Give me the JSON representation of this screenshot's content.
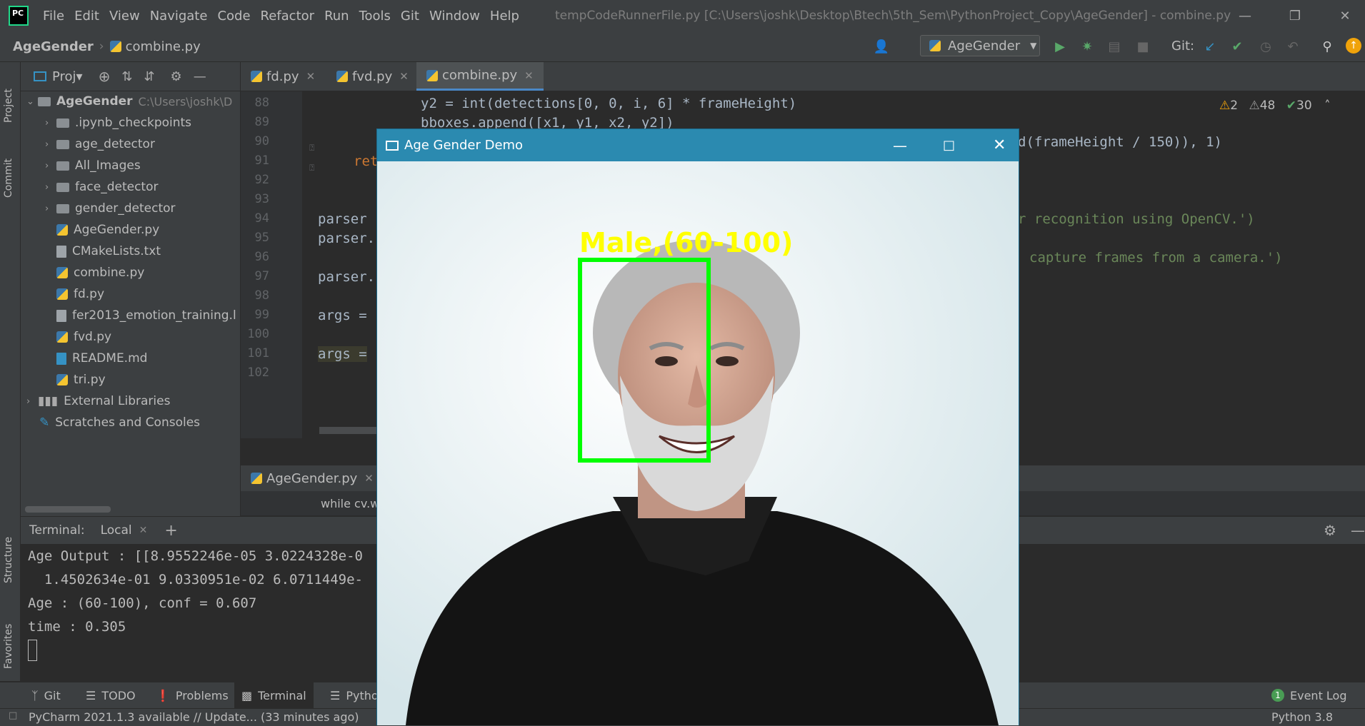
{
  "menubar": {
    "logo": "PC",
    "items": [
      "File",
      "Edit",
      "View",
      "Navigate",
      "Code",
      "Refactor",
      "Run",
      "Tools",
      "Git",
      "Window",
      "Help"
    ],
    "title": "tempCodeRunnerFile.py [C:\\Users\\joshk\\Desktop\\Btech\\5th_Sem\\PythonProject_Copy\\AgeGender] - combine.py"
  },
  "navbar": {
    "project": "AgeGender",
    "file": "combine.py",
    "run_config": "AgeGender",
    "git_label": "Git:"
  },
  "project_panel": {
    "title": "Proj▾",
    "root": "AgeGender",
    "root_path": "C:\\Users\\joshk\\D",
    "items": [
      {
        "label": ".ipynb_checkpoints",
        "type": "folder"
      },
      {
        "label": "age_detector",
        "type": "folder"
      },
      {
        "label": "All_Images",
        "type": "folder"
      },
      {
        "label": "face_detector",
        "type": "folder"
      },
      {
        "label": "gender_detector",
        "type": "folder"
      },
      {
        "label": "AgeGender.py",
        "type": "py"
      },
      {
        "label": "CMakeLists.txt",
        "type": "file"
      },
      {
        "label": "combine.py",
        "type": "py"
      },
      {
        "label": "fd.py",
        "type": "py"
      },
      {
        "label": "fer2013_emotion_training.l",
        "type": "file"
      },
      {
        "label": "fvd.py",
        "type": "py"
      },
      {
        "label": "README.md",
        "type": "md"
      },
      {
        "label": "tri.py",
        "type": "py"
      }
    ],
    "external": "External Libraries",
    "scratches": "Scratches and Consoles"
  },
  "left_stripe": {
    "project": "Project",
    "commit": "Commit",
    "structure": "Structure",
    "favorites": "Favorites"
  },
  "editor_tabs": [
    "fd.py",
    "fvd.py",
    "combine.py"
  ],
  "inspections": {
    "warnings": "2",
    "weak": "48",
    "ok": "30"
  },
  "code": {
    "line_numbers": [
      "88",
      "89",
      "90",
      "91",
      "92",
      "93",
      "94",
      "95",
      "96",
      "97",
      "98",
      "99",
      "100",
      "101",
      "102"
    ],
    "l88": "y2 = int(detections[0, 0, i, 6] * frameHeight)",
    "l89": "bboxes.append([x1, y1, x2, y2])",
    "l90_right": "d(frameHeight / 150)), 1)",
    "l91": "ret",
    "l94a": "parser",
    "l94_right": "r recognition using OpenCV.')",
    "l95": "parser.",
    "l96_right": "capture frames from a camera.')",
    "l97": "parser.",
    "l99": "args =",
    "l101": "args ="
  },
  "lower_tabs": {
    "tab": "AgeGender.py",
    "crumb": "while cv.w"
  },
  "terminal": {
    "label": "Terminal:",
    "tab": "Local",
    "lines": [
      "Age Output : [[8.9552246e-05 3.0224328e-0",
      "  1.4502634e-01 9.0330951e-02 6.0711449e-",
      "Age : (60-100), conf = 0.607",
      "time : 0.305"
    ]
  },
  "bottom_tools": [
    "Git",
    "TODO",
    "Problems",
    "Terminal",
    "Pytho"
  ],
  "event_log": {
    "count": "1",
    "label": "Event Log"
  },
  "status": {
    "message": "PyCharm 2021.1.3 available // Update... (33 minutes ago)",
    "interpreter": "Python 3.8"
  },
  "cv_window": {
    "title": "Age Gender Demo",
    "prediction": "Male,(60-100)"
  },
  "colors": {
    "accent_green": "#00ff00",
    "label_yellow": "#ffff00",
    "cv_title": "#2b8ab0"
  }
}
